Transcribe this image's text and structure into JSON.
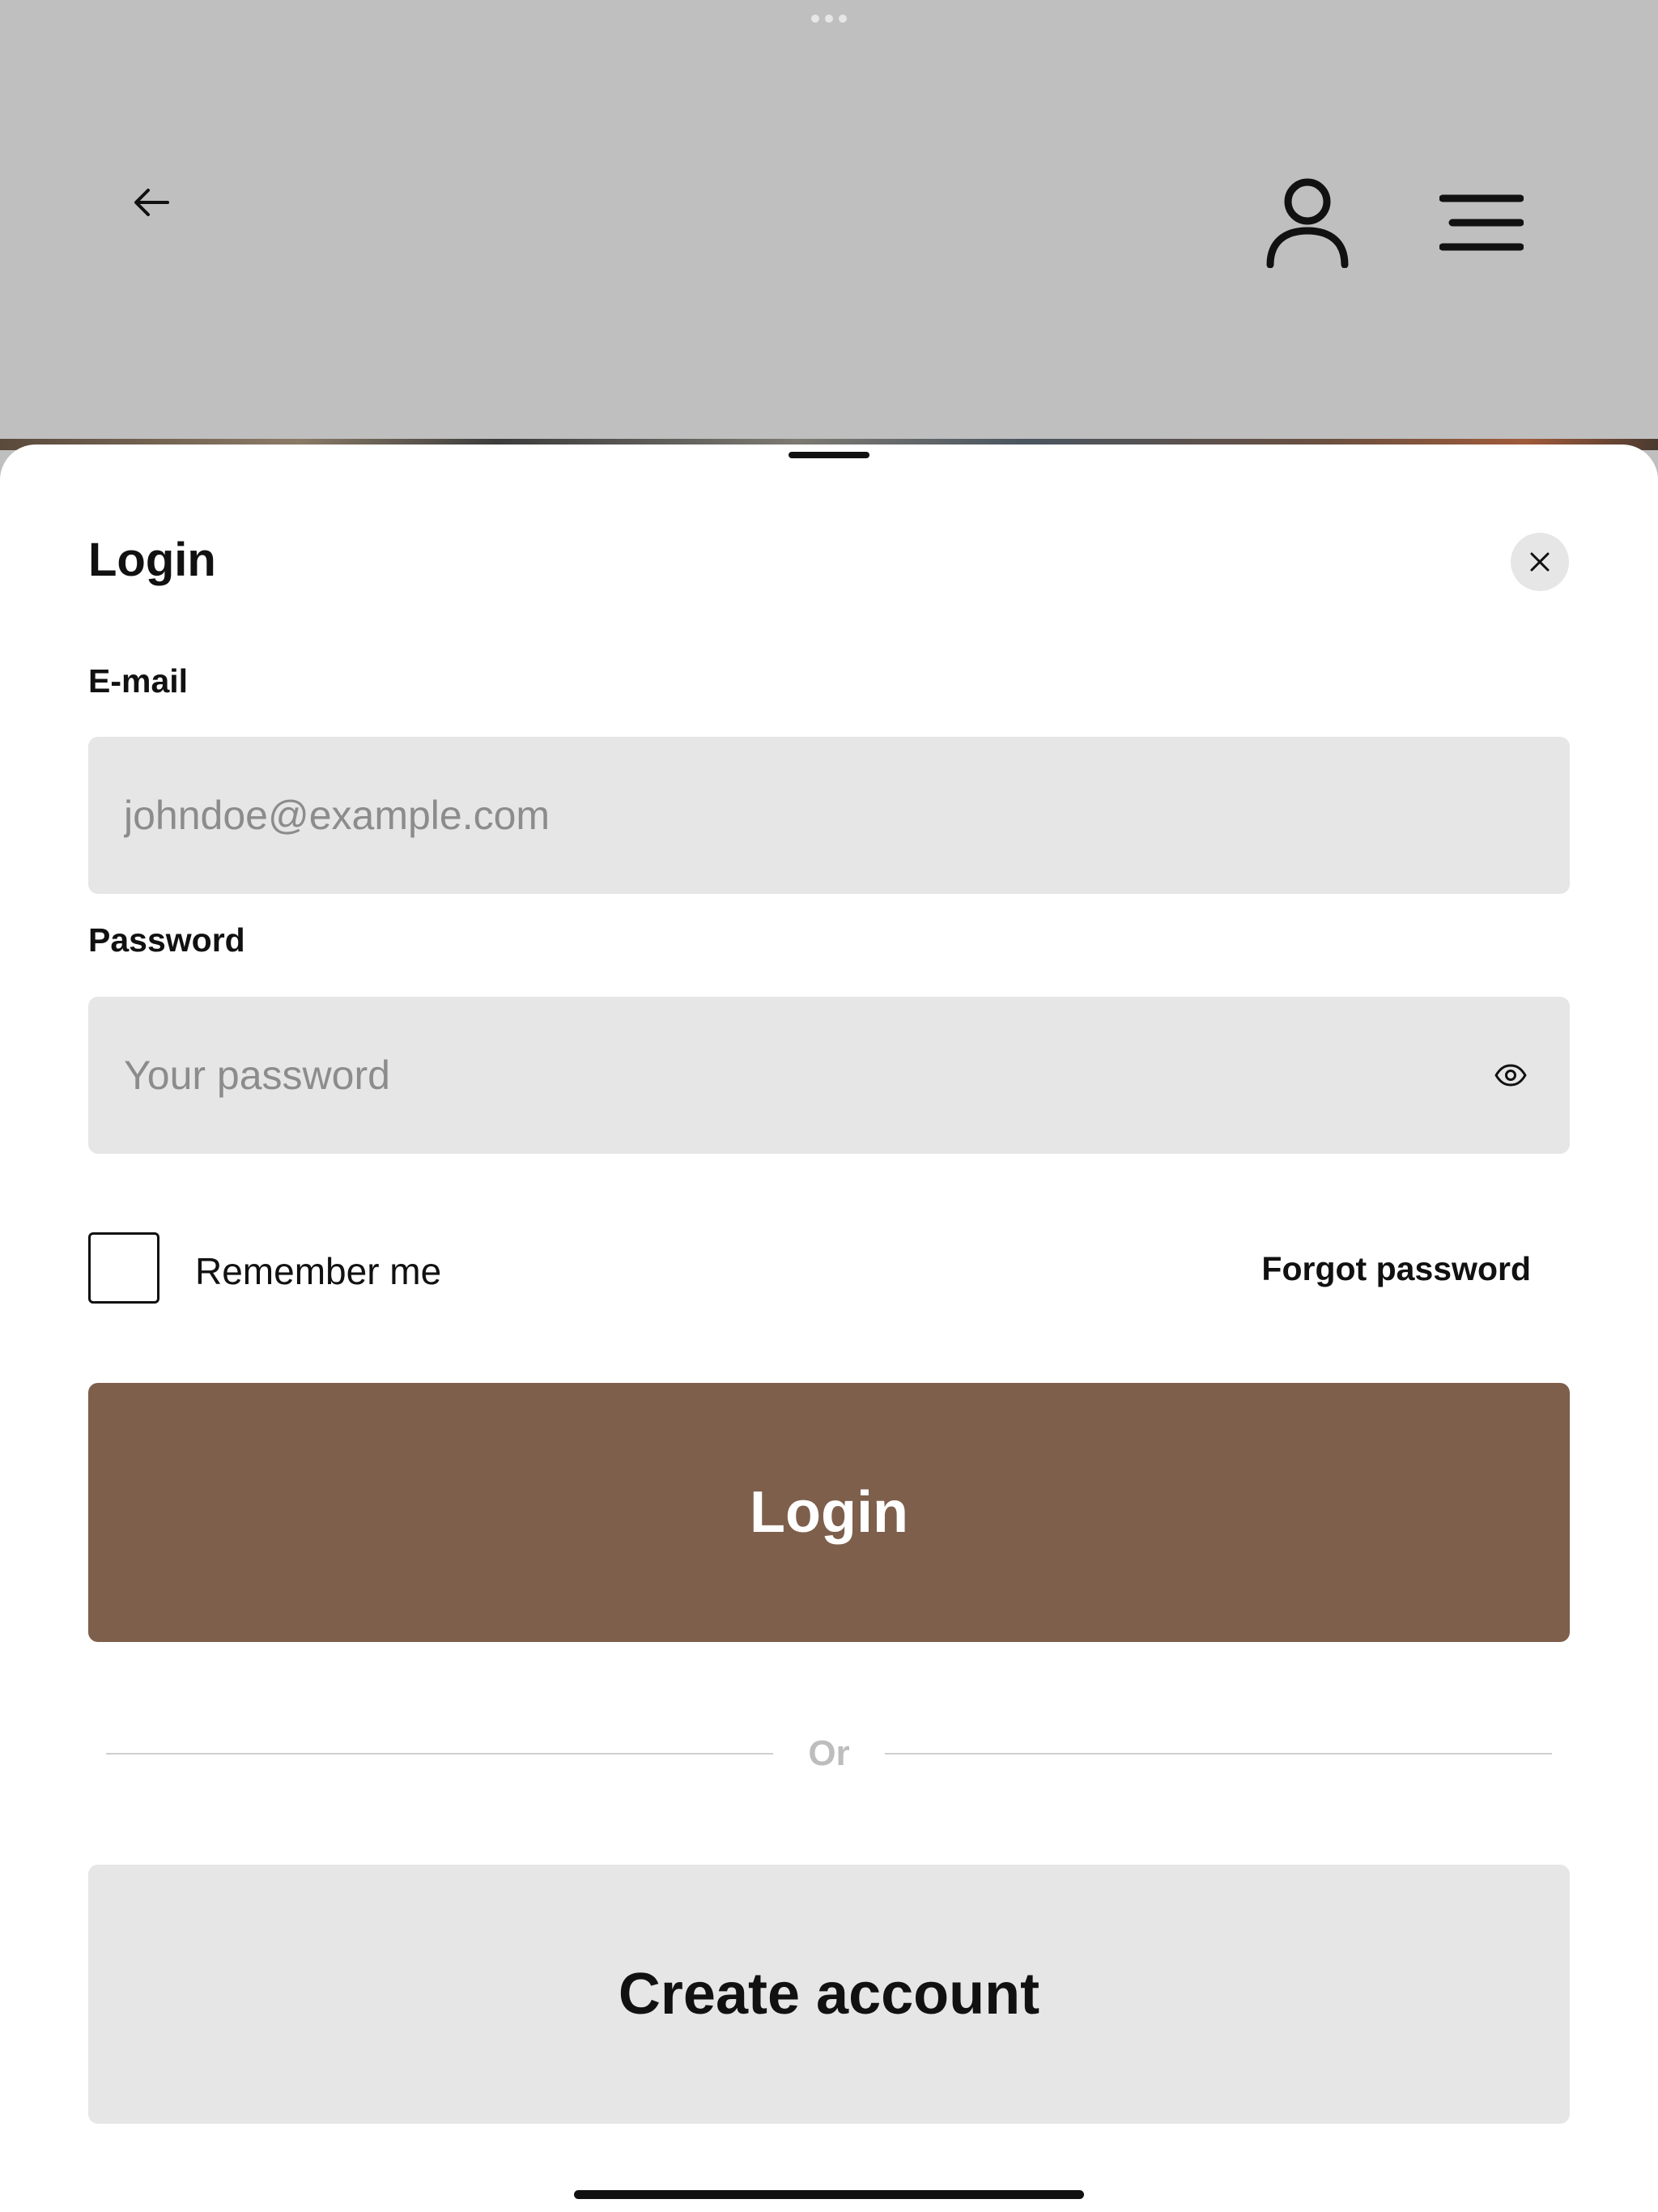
{
  "header": {
    "back_icon": "arrow-left-icon",
    "account_icon": "user-icon",
    "menu_icon": "menu-icon"
  },
  "login_sheet": {
    "title": "Login",
    "close_icon": "close-icon",
    "email": {
      "label": "E-mail",
      "value": "",
      "placeholder": "johndoe@example.com"
    },
    "password": {
      "label": "Password",
      "value": "",
      "placeholder": "Your password",
      "toggle_icon": "eye-icon"
    },
    "remember_me": {
      "label": "Remember me",
      "checked": false
    },
    "forgot_password_label": "Forgot password",
    "login_button_label": "Login",
    "divider_text": "Or",
    "create_account_label": "Create account"
  },
  "colors": {
    "backdrop": "#bfbfbf",
    "primary_button": "#7e5f4c",
    "input_background": "#e6e6e6",
    "divider_text": "#bdbdbd"
  }
}
